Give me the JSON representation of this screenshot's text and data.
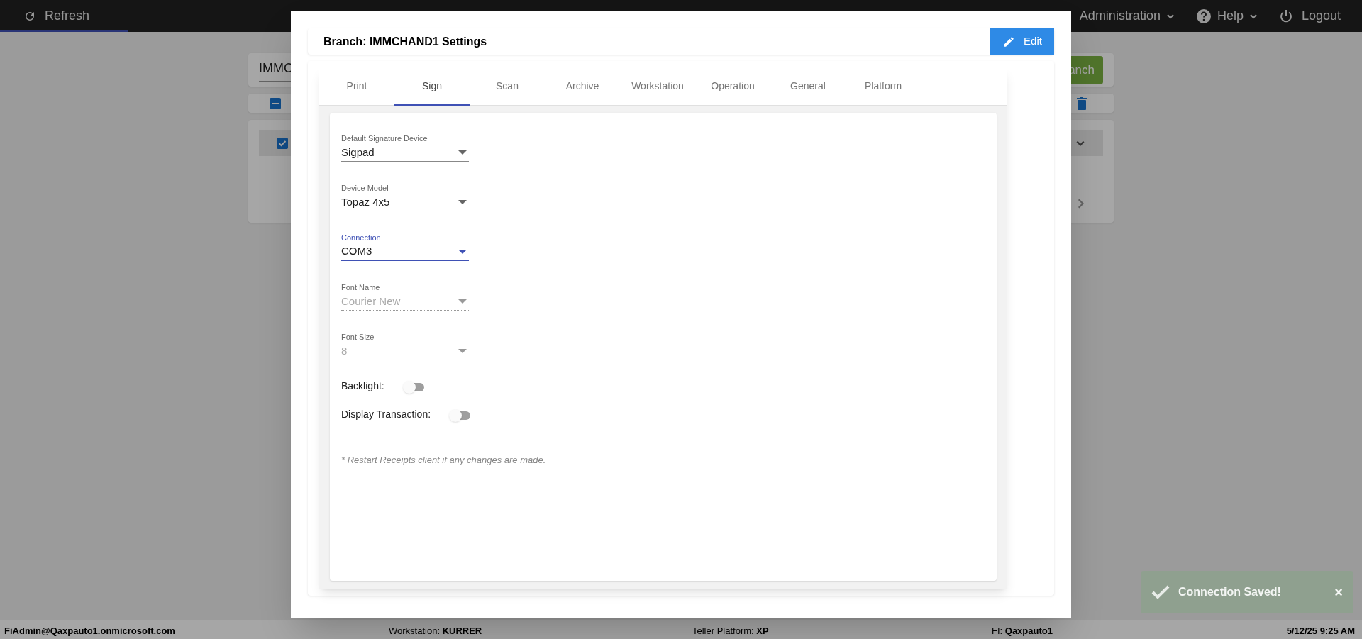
{
  "top_bar": {
    "refresh": "Refresh",
    "progress": {
      "level": 0.094
    },
    "menus": [
      {
        "label": "Administration"
      },
      {
        "label": "Help"
      }
    ],
    "logout": "Logout"
  },
  "background": {
    "search_value": "IMMC",
    "button": "anch",
    "row_checked": true
  },
  "dialog": {
    "title": "Branch: IMMCHAND1 Settings",
    "edit_button": "Edit",
    "tabs": [
      {
        "label": "Print",
        "selected": false
      },
      {
        "label": "Sign",
        "selected": true
      },
      {
        "label": "Scan",
        "selected": false
      },
      {
        "label": "Archive",
        "selected": false
      },
      {
        "label": "Workstation",
        "selected": false
      },
      {
        "label": "Operation",
        "selected": false
      },
      {
        "label": "General",
        "selected": false
      },
      {
        "label": "Platform",
        "selected": false
      }
    ],
    "fields": [
      {
        "label": "Default Signature Device",
        "value": "Sigpad",
        "focused": false,
        "disabled": false
      },
      {
        "label": "Device Model",
        "value": "Topaz 4x5",
        "focused": false,
        "disabled": false
      },
      {
        "label": "Connection",
        "value": "COM3",
        "focused": true,
        "disabled": false
      },
      {
        "label": "Font Name",
        "value": "Courier New",
        "focused": false,
        "disabled": true
      },
      {
        "label": "Font Size",
        "value": "8",
        "focused": false,
        "disabled": true
      }
    ],
    "toggles": [
      {
        "label": "Backlight:",
        "on": false
      },
      {
        "label": "Display Transaction:",
        "on": false
      }
    ],
    "note": "* Restart Receipts client if any changes are made."
  },
  "status_bar": {
    "user": "FiAdmin@Qaxpauto1.onmicrosoft.com",
    "items": [
      {
        "label": "Workstation:",
        "value": "KURRER"
      },
      {
        "label": "Teller Platform:",
        "value": "XP"
      },
      {
        "label": "FI:",
        "value": "Qaxpauto1"
      }
    ],
    "datetime": "5/12/25 9:25 AM"
  },
  "toast": {
    "message": "Connection Saved!",
    "close": "×"
  }
}
